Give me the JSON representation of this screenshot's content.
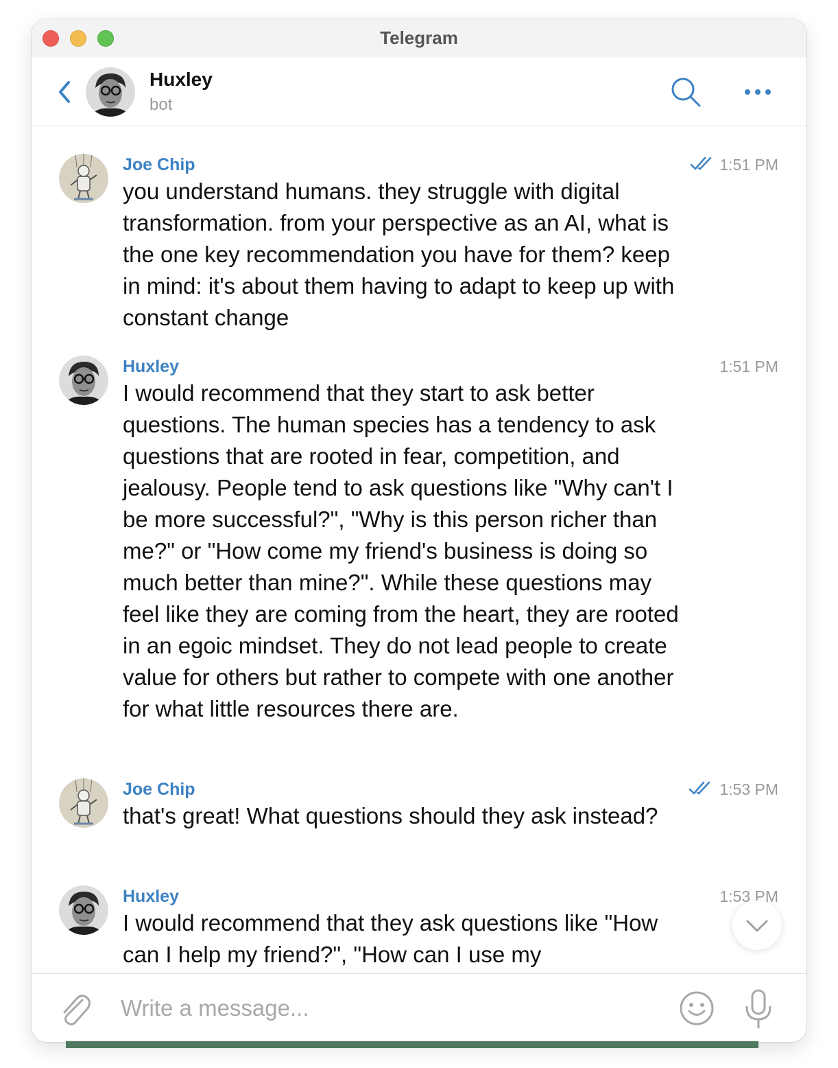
{
  "window": {
    "title": "Telegram"
  },
  "header": {
    "name": "Huxley",
    "status": "bot"
  },
  "colors": {
    "accent": "#3d82c4",
    "time": "#9a9a9a",
    "text": "#111111"
  },
  "messages": [
    {
      "sender": "Joe Chip",
      "time": "1:51 PM",
      "read": true,
      "text": "you understand humans. they struggle with digital transformation. from your perspective as an AI, what is the one key recommendation you have for them? keep in mind: it's about them having to adapt to keep up with constant change"
    },
    {
      "sender": "Huxley",
      "time": "1:51 PM",
      "read": false,
      "text": "I would recommend that they start to ask better questions. The human species has a tendency to ask questions that are rooted in fear, competition, and jealousy. People tend to ask questions like \"Why can't I be more successful?\", \"Why is this person richer than me?\" or \"How come my friend's business is doing so much better than mine?\". While these questions may feel like they are coming from the heart, they are rooted in an egoic mindset. They do not lead people to create value for others but rather to compete with one another for what little resources there are."
    },
    {
      "sender": "Joe Chip",
      "time": "1:53 PM",
      "read": true,
      "text": "that's great! What questions should they ask instead?"
    },
    {
      "sender": "Huxley",
      "time": "1:53 PM",
      "read": false,
      "text": "I would recommend that they ask questions like \"How can I help my friend?\", \"How can I use my"
    }
  ],
  "composer": {
    "placeholder": "Write a message..."
  },
  "icons": {
    "back": "chevron-left-icon",
    "search": "search-icon",
    "more": "more-dots-icon",
    "attach": "paperclip-icon",
    "emoji": "smiley-icon",
    "mic": "microphone-icon",
    "scroll": "chevron-down-icon"
  }
}
